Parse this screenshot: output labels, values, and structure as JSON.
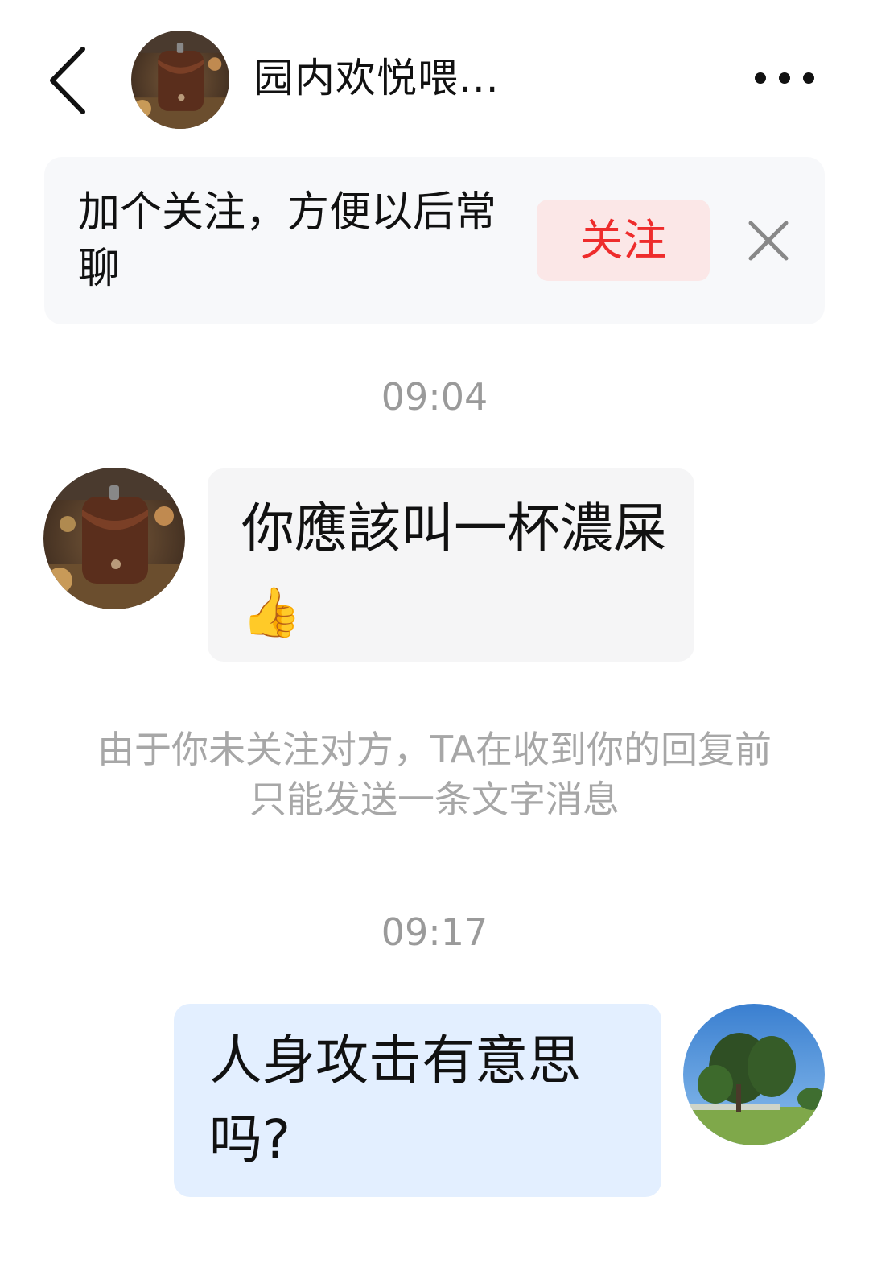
{
  "header": {
    "contact_name": "园内欢悦喂...",
    "back_icon": "chevron-left-icon",
    "more_icon": "more-horizontal-icon"
  },
  "follow_banner": {
    "text": "加个关注，方便以后常聊",
    "button_label": "关注",
    "close_icon": "close-icon"
  },
  "messages": [
    {
      "timestamp": "09:04",
      "sender": "other",
      "text": "你應該叫一杯濃屎",
      "emoji": "👍"
    },
    {
      "notice": "由于你未关注对方，TA在收到你的回复前只能发送一条文字消息"
    },
    {
      "timestamp": "09:17",
      "sender": "self",
      "text": "人身攻击有意思吗?"
    }
  ],
  "colors": {
    "follow_button_text": "#ee2c2c",
    "follow_button_bg": "#fbe7e7",
    "self_bubble_bg": "#e3efff",
    "other_bubble_bg": "#f5f5f6",
    "timestamp_text": "#9a9a9a"
  }
}
